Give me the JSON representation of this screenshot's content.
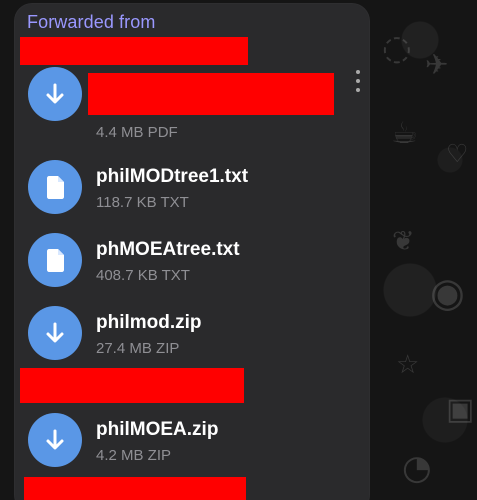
{
  "chat": {
    "forwarded_label": "Forwarded from"
  },
  "files": [
    {
      "name": "",
      "meta": "4.4 MB PDF",
      "icon": "download-icon"
    },
    {
      "name": "philMODtree1.txt",
      "meta": "118.7 KB TXT",
      "icon": "document-icon"
    },
    {
      "name": "phMOEAtree.txt",
      "meta": "408.7 KB TXT",
      "icon": "document-icon"
    },
    {
      "name": "philmod.zip",
      "meta": "27.4 MB ZIP",
      "icon": "download-icon"
    },
    {
      "name": "philMOEA.zip",
      "meta": "4.2 MB ZIP",
      "icon": "download-icon"
    }
  ],
  "colors": {
    "accent": "#9a98ff",
    "file_icon": "#5a97e6",
    "redaction": "#ff0000",
    "bubble": "#2a2a2c"
  }
}
